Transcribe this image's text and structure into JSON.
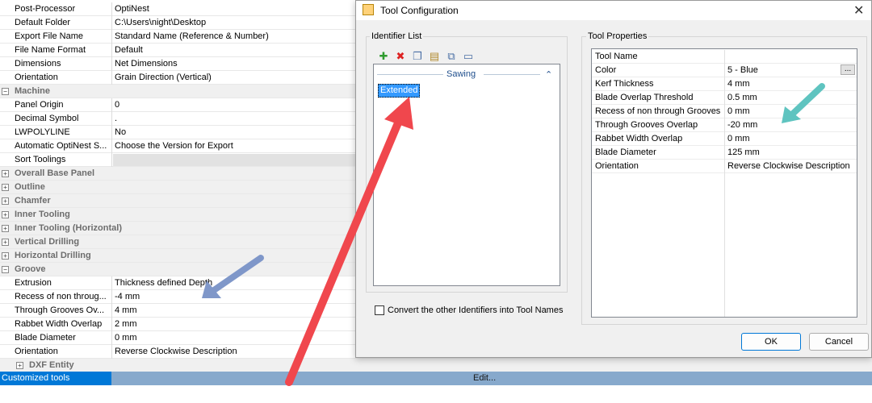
{
  "grid": {
    "rows": [
      {
        "kind": "prop",
        "label": "Post-Processor",
        "value": "OptiNest"
      },
      {
        "kind": "prop",
        "label": "Default Folder",
        "value": "C:\\Users\\night\\Desktop"
      },
      {
        "kind": "prop",
        "label": "Export File Name",
        "value": "Standard Name (Reference & Number)"
      },
      {
        "kind": "prop",
        "label": "File Name Format",
        "value": "Default"
      },
      {
        "kind": "prop",
        "label": "Dimensions",
        "value": "Net Dimensions"
      },
      {
        "kind": "prop",
        "label": "Orientation",
        "value": "Grain Direction (Vertical)"
      },
      {
        "kind": "cat",
        "label": "Machine",
        "toggle": "−"
      },
      {
        "kind": "prop",
        "label": "Panel Origin",
        "value": "0"
      },
      {
        "kind": "prop",
        "label": "Decimal Symbol",
        "value": "."
      },
      {
        "kind": "prop",
        "label": "LWPOLYLINE",
        "value": "No"
      },
      {
        "kind": "prop",
        "label": "Automatic OptiNest S...",
        "value": "Choose the Version for Export"
      },
      {
        "kind": "prop",
        "label": "Sort Toolings",
        "value": ""
      },
      {
        "kind": "cat",
        "label": "Overall Base Panel",
        "toggle": "+"
      },
      {
        "kind": "cat",
        "label": "Outline",
        "toggle": "+"
      },
      {
        "kind": "cat",
        "label": "Chamfer",
        "toggle": "+"
      },
      {
        "kind": "cat",
        "label": "Inner Tooling",
        "toggle": "+"
      },
      {
        "kind": "cat",
        "label": "Inner Tooling (Horizontal)",
        "toggle": "+"
      },
      {
        "kind": "cat",
        "label": "Vertical Drilling",
        "toggle": "+"
      },
      {
        "kind": "cat",
        "label": "Horizontal Drilling",
        "toggle": "+"
      },
      {
        "kind": "cat",
        "label": "Groove",
        "toggle": "−"
      },
      {
        "kind": "prop",
        "label": "Extrusion",
        "value": "Thickness defined Depth"
      },
      {
        "kind": "prop",
        "label": "Recess of non throug...",
        "value": "-4 mm"
      },
      {
        "kind": "prop",
        "label": "Through Grooves Ov...",
        "value": "4 mm"
      },
      {
        "kind": "prop",
        "label": "Rabbet Width Overlap",
        "value": "2 mm"
      },
      {
        "kind": "prop",
        "label": "Blade Diameter",
        "value": "0 mm"
      },
      {
        "kind": "prop",
        "label": "Orientation",
        "value": "Reverse Clockwise Description"
      },
      {
        "kind": "sub",
        "label": "DXF Entity",
        "toggle": "+"
      }
    ],
    "customized": {
      "label": "Customized tools",
      "edit": "Edit..."
    }
  },
  "dialog": {
    "title": "Tool Configuration",
    "close": "✕",
    "identifier_list": {
      "label": "Identifier List",
      "toolbar": [
        {
          "name": "add-icon",
          "glyph": "✚",
          "color": "#2e9b2e"
        },
        {
          "name": "delete-icon",
          "glyph": "✖",
          "color": "#d22"
        },
        {
          "name": "copy-icon",
          "glyph": "❐",
          "color": "#4a6fa5"
        },
        {
          "name": "paste-icon",
          "glyph": "▤",
          "color": "#b08a2e"
        },
        {
          "name": "duplicate-icon",
          "glyph": "⧉",
          "color": "#4a6fa5"
        },
        {
          "name": "rename-icon",
          "glyph": "▭",
          "color": "#4a6fa5"
        }
      ],
      "group_header": "Sawing",
      "selected_item": "Extended"
    },
    "convert_checkbox_label": "Convert the other Identifiers into Tool Names",
    "tool_properties": {
      "label": "Tool Properties",
      "rows": [
        {
          "label": "Tool Name",
          "value": ""
        },
        {
          "label": "Color",
          "value": "5 - Blue"
        },
        {
          "label": "Kerf Thickness",
          "value": "4 mm"
        },
        {
          "label": "Blade Overlap Threshold",
          "value": "0.5 mm"
        },
        {
          "label": "Recess of non through Grooves",
          "value": "0 mm"
        },
        {
          "label": "Through Grooves Overlap",
          "value": "-20 mm"
        },
        {
          "label": "Rabbet Width Overlap",
          "value": "0 mm"
        },
        {
          "label": "Blade Diameter",
          "value": "125 mm"
        },
        {
          "label": "Orientation",
          "value": "Reverse Clockwise Description"
        }
      ],
      "ellipsis": "..."
    },
    "ok": "OK",
    "cancel": "Cancel"
  },
  "annotations": {
    "arrow_colors": {
      "red": "#f0474d",
      "blue": "#7f97c9",
      "teal": "#5fc4c0"
    }
  }
}
